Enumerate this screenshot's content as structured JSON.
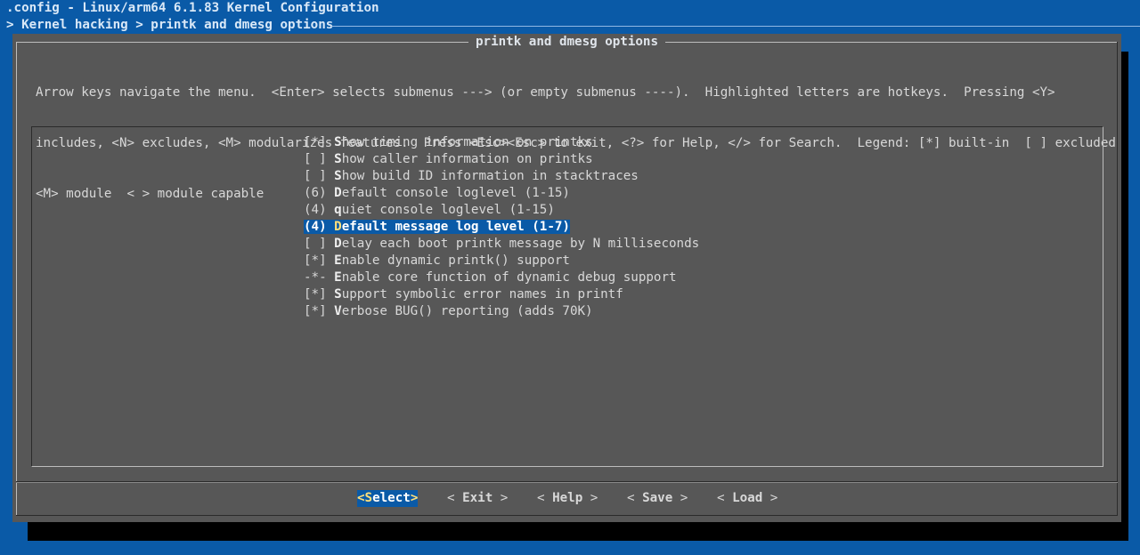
{
  "window": {
    "title": ".config - Linux/arm64 6.1.83 Kernel Configuration",
    "breadcrumb": "> Kernel hacking > printk and dmesg options"
  },
  "dialog": {
    "title": "printk and dmesg options",
    "help_lines": [
      "Arrow keys navigate the menu.  <Enter> selects submenus ---> (or empty submenus ----).  Highlighted letters are hotkeys.  Pressing <Y>",
      "includes, <N> excludes, <M> modularizes features.  Press <Esc><Esc> to exit, <?> for Help, </> for Search.  Legend: [*] built-in  [ ] excluded",
      "<M> module  < > module capable"
    ]
  },
  "menu": {
    "items": [
      {
        "prefix": "[*] ",
        "hotkey": "S",
        "rest": "how timing information on printks",
        "selected": false
      },
      {
        "prefix": "[ ] ",
        "hotkey": "S",
        "rest": "how caller information on printks",
        "selected": false
      },
      {
        "prefix": "[ ] ",
        "hotkey": "S",
        "rest": "how build ID information in stacktraces",
        "selected": false
      },
      {
        "prefix": "(6) ",
        "hotkey": "D",
        "rest": "efault console loglevel (1-15)",
        "selected": false
      },
      {
        "prefix": "(4) ",
        "hotkey": "q",
        "rest": "uiet console loglevel (1-15)",
        "selected": false
      },
      {
        "prefix": "(4) ",
        "hotkey": "D",
        "rest": "efault message log level (1-7)",
        "selected": true
      },
      {
        "prefix": "[ ] ",
        "hotkey": "D",
        "rest": "elay each boot printk message by N milliseconds",
        "selected": false
      },
      {
        "prefix": "[*] ",
        "hotkey": "E",
        "rest": "nable dynamic printk() support",
        "selected": false
      },
      {
        "prefix": "-*- ",
        "hotkey": "E",
        "rest": "nable core function of dynamic debug support",
        "selected": false
      },
      {
        "prefix": "[*] ",
        "hotkey": "S",
        "rest": "upport symbolic error names in printf",
        "selected": false
      },
      {
        "prefix": "[*] ",
        "hotkey": "V",
        "rest": "erbose BUG() reporting (adds 70K)",
        "selected": false
      }
    ]
  },
  "buttons": {
    "select": {
      "open": "<",
      "hot": "S",
      "rest": "elect",
      "close": ">"
    },
    "exit": {
      "open": "< ",
      "hot": "E",
      "rest": "xit",
      "close": " >"
    },
    "help": {
      "open": "< ",
      "hot": "H",
      "rest": "elp",
      "close": " >"
    },
    "save": {
      "open": "< ",
      "hot": "S",
      "rest": "ave",
      "close": " >"
    },
    "load": {
      "open": "< ",
      "hot": "L",
      "rest": "oad",
      "close": " >"
    }
  },
  "colors": {
    "background": "#0a5aa7",
    "dialog": "#575757",
    "highlight": "#0a5aa7",
    "hotkey_selected": "#ffe07a"
  }
}
